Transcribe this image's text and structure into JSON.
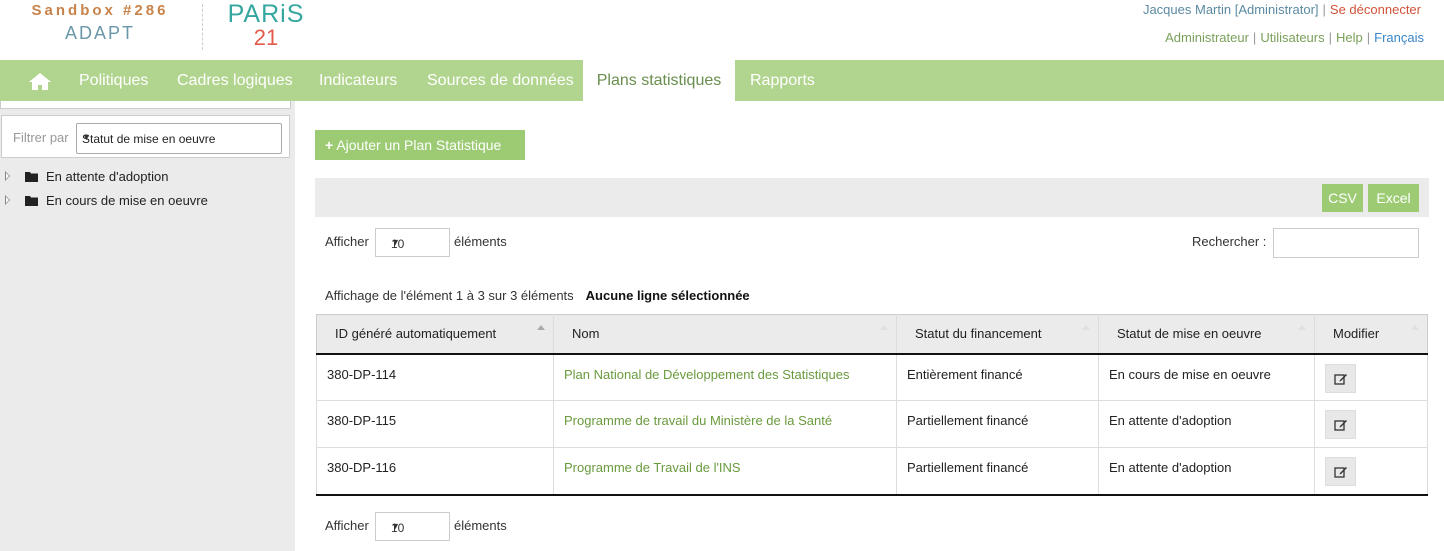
{
  "header": {
    "sandbox_title": "Sandbox #286",
    "sandbox_subtitle": "ADAPT",
    "paris_logo_top": "PARiS",
    "paris_logo_bottom": "21",
    "user": "Jacques Martin [Administrator]",
    "logout": "Se déconnecter",
    "links": [
      "Administrateur",
      "Utilisateurs",
      "Help"
    ],
    "language": "Français"
  },
  "nav": {
    "home_icon": "home-icon",
    "items": [
      "Politiques",
      "Cadres logiques",
      "Indicateurs",
      "Sources de données",
      "Plans statistiques",
      "Rapports"
    ],
    "active": "Plans statistiques"
  },
  "sidebar": {
    "filter_label": "Filtrer par",
    "filter_value": "Statut de mise en oeuvre",
    "tree": [
      "En attente d'adoption",
      "En cours de mise en oeuvre"
    ]
  },
  "main": {
    "add_button": "Ajouter un Plan Statistique",
    "export": {
      "csv": "CSV",
      "excel": "Excel"
    },
    "length": {
      "prefix": "Afficher",
      "value": "10",
      "suffix": "éléments"
    },
    "search_label": "Rechercher :",
    "info": "Affichage de l'élément 1 à 3 sur 3 éléments",
    "selection_info": "Aucune ligne sélectionnée",
    "columns": [
      "ID généré automatiquement",
      "Nom",
      "Statut du financement",
      "Statut de mise en oeuvre",
      "Modifier"
    ],
    "rows": [
      {
        "id": "380-DP-114",
        "nom": "Plan National de Développement des Statistiques",
        "financement": "Entièrement financé",
        "mise_en_oeuvre": "En cours de mise en oeuvre"
      },
      {
        "id": "380-DP-115",
        "nom": "Programme de travail du Ministère de la Santé",
        "financement": "Partiellement financé",
        "mise_en_oeuvre": "En attente d'adoption"
      },
      {
        "id": "380-DP-116",
        "nom": "Programme de Travail de l'INS",
        "financement": "Partiellement financé",
        "mise_en_oeuvre": "En attente d'adoption"
      }
    ]
  },
  "colors": {
    "nav_green": "#b1d58e",
    "button_green": "#9ccb74",
    "link_green": "#6a9a3e"
  }
}
